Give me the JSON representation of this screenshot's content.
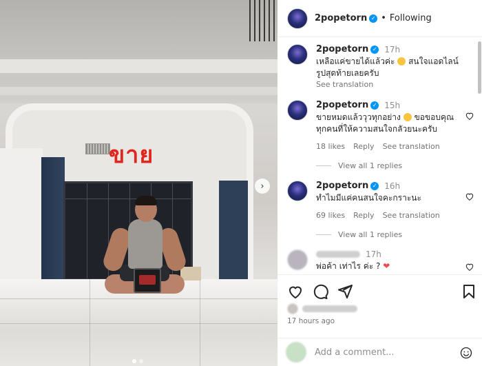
{
  "post": {
    "overlay_text": "ขาย"
  },
  "header": {
    "username": "2popetorn",
    "separator": "•",
    "follow_status": "Following"
  },
  "comments": [
    {
      "username": "2popetorn",
      "time": "17h",
      "text_1": "เหลือแค่ขายได้แล้วค่ะ",
      "text_2": "สนใจแอดไลน์",
      "text_3": "รูปสุดท้ายเลยครับ",
      "see_translation": "See translation"
    },
    {
      "username": "2popetorn",
      "time": "15h",
      "text_1": "ขายหมดแล้ววุวทุกอย่าง",
      "text_2": "ขอขอบคุณ",
      "text_3": "ทุกคนที่ให้ความสนใจกลัวยนะครับ",
      "likes": "18 likes",
      "reply": "Reply",
      "see_translation": "See translation",
      "view_replies": "View all 1 replies"
    },
    {
      "username": "2popetorn",
      "time": "16h",
      "text_1": "ทำไมมีแค่คนสนใจคะกราะนะ",
      "likes": "69 likes",
      "reply": "Reply",
      "see_translation": "See translation",
      "view_replies": "View all 1 replies"
    },
    {
      "time": "17h",
      "text_1": "พ่อค้า เท่าไร ค่ะ ?"
    }
  ],
  "footer": {
    "timestamp": "17 hours ago",
    "add_comment_placeholder": "Add a comment..."
  },
  "colors": {
    "verified": "#0095f6",
    "overlay_text": "#e0261d",
    "red_heart": "#ed4956"
  }
}
